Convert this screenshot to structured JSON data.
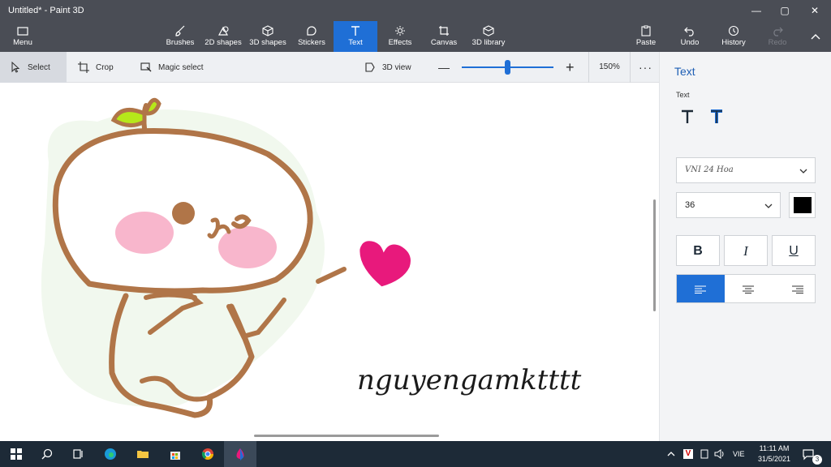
{
  "window": {
    "title": "Untitled* - Paint 3D"
  },
  "ribbon": {
    "menu": "Menu",
    "tools": [
      {
        "label": "Brushes"
      },
      {
        "label": "2D shapes"
      },
      {
        "label": "3D shapes"
      },
      {
        "label": "Stickers"
      },
      {
        "label": "Text"
      },
      {
        "label": "Effects"
      },
      {
        "label": "Canvas"
      },
      {
        "label": "3D library"
      }
    ],
    "paste": "Paste",
    "undo": "Undo",
    "history": "History",
    "redo": "Redo"
  },
  "toolbar": {
    "select": "Select",
    "crop": "Crop",
    "magic_select": "Magic select",
    "view_3d": "3D view",
    "zoom_percent": "150%",
    "zoom_slider_fraction": 0.5
  },
  "canvas": {
    "signature_text": "nguyengamktttt"
  },
  "panel": {
    "title": "Text",
    "subtitle": "Text",
    "font_preview": "VNI 24 Hoa",
    "font_size": "36",
    "color": "#000000",
    "bold": "B",
    "italic": "I",
    "underline": "U"
  },
  "taskbar": {
    "language": "VIE",
    "time": "11:11 AM",
    "date": "31/5/2021",
    "notifications_count": "3"
  },
  "colors": {
    "ribbon_bg": "#4a4d55",
    "accent": "#1f6fd6",
    "taskbar_bg": "#1d2a37",
    "doodle_outline": "#b07548",
    "heart": "#e8197c",
    "leaf": "#b6e81a",
    "cheek": "#f7a9c3"
  }
}
